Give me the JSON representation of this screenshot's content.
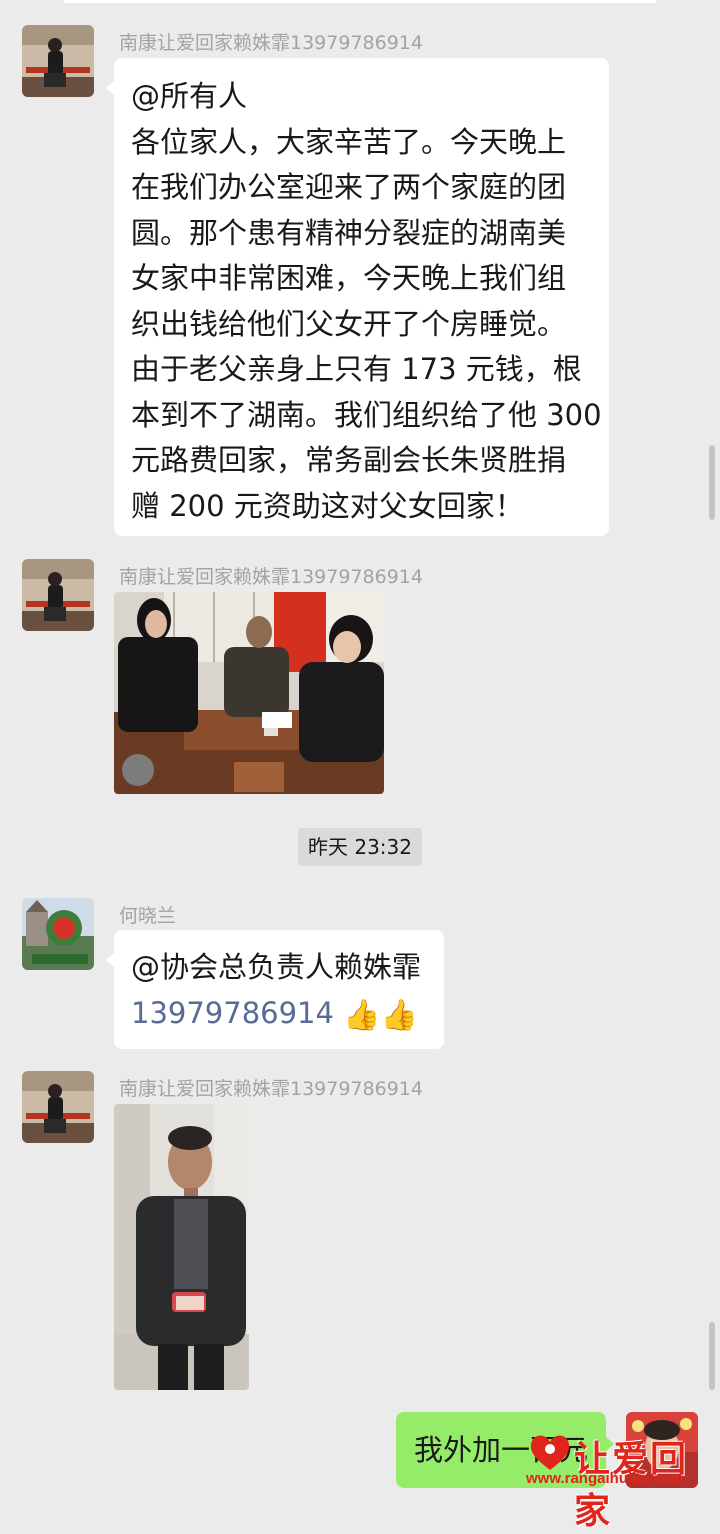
{
  "messages": [
    {
      "sender": "南康让爱回家赖姝霏13979786914",
      "lines": [
        "@所有人",
        "各位家人，大家辛苦了。今天晚上",
        "在我们办公室迎来了两个家庭的团",
        "圆。那个患有精神分裂症的湖南美",
        "女家中非常困难，今天晚上我们组",
        "织出钱给他们父女开了个房睡觉。",
        "由于老父亲身上只有 173 元钱，根",
        "本到不了湖南。我们组织给了他 300",
        "元路费回家，常务副会长朱贤胜捐",
        "赠 200 元资助这对父女回家！"
      ]
    },
    {
      "sender": "南康让爱回家赖姝霏13979786914"
    },
    {
      "sender": "何晓兰",
      "mention": "@协会总负责人赖姝霏",
      "phone": "13979786914",
      "thumbs": "👍👍"
    },
    {
      "sender": "南康让爱回家赖姝霏13979786914"
    },
    {
      "text": "我外加一百元"
    }
  ],
  "timestamp": "昨天 23:32",
  "watermark": {
    "text": "让爱回家",
    "url": "www.rangaihuijia.com"
  },
  "colors": {
    "background": "#ebebeb",
    "bubble_in": "#ffffff",
    "bubble_out": "#95ec69",
    "link": "#576b95",
    "sender_name": "#a3a3a3"
  }
}
